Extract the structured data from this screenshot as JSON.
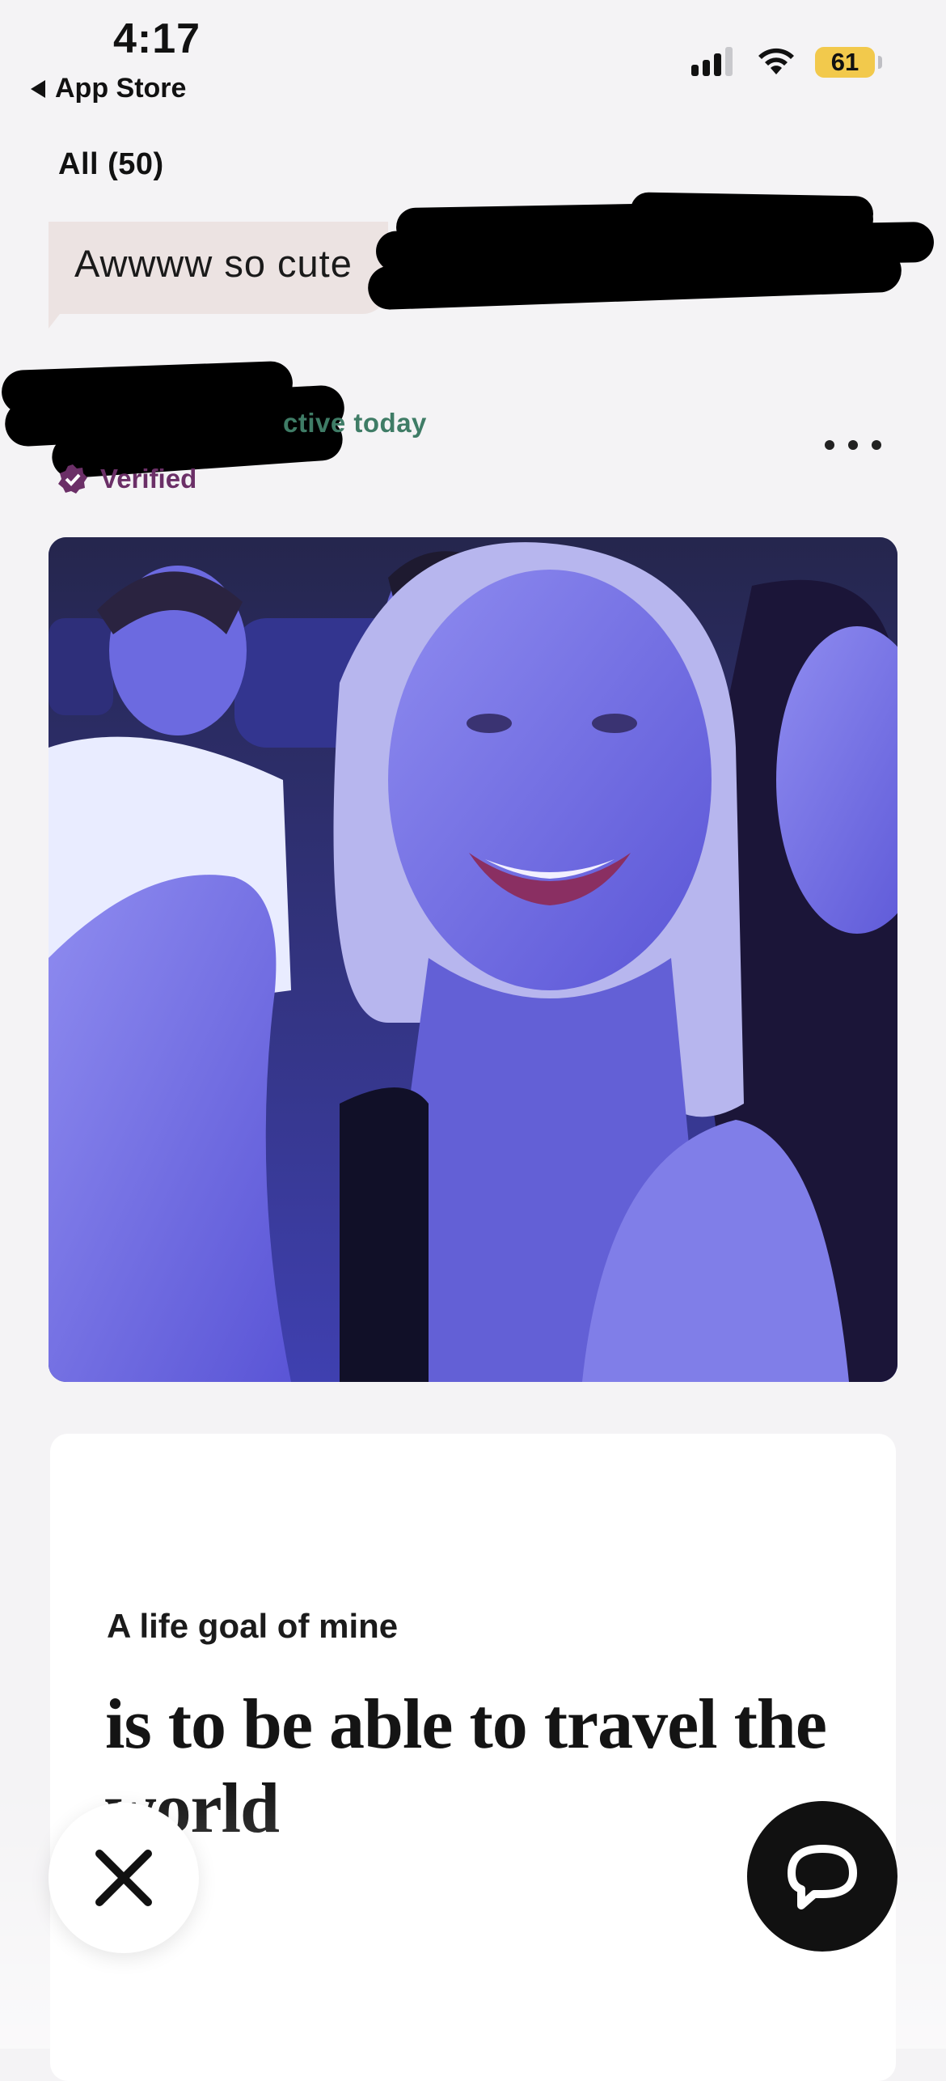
{
  "status_bar": {
    "time": "4:17",
    "back_label": "App Store",
    "battery": "61"
  },
  "header": {
    "filter_label": "All (50)"
  },
  "message": {
    "text": "Awwww so cute"
  },
  "profile": {
    "active_status": "ctive today",
    "verified_label": "Verified"
  },
  "prompt": {
    "question": "A life goal of mine",
    "answer": "is to be able to travel the world"
  },
  "icons": {
    "more": "more-options-icon",
    "skip": "close-icon",
    "comment": "chat-bubble-icon",
    "verified": "verified-badge-icon"
  },
  "colors": {
    "active_green": "#3f7c66",
    "verified_purple": "#6b2f67",
    "bubble": "#ece3e2",
    "battery": "#f2c94c"
  }
}
